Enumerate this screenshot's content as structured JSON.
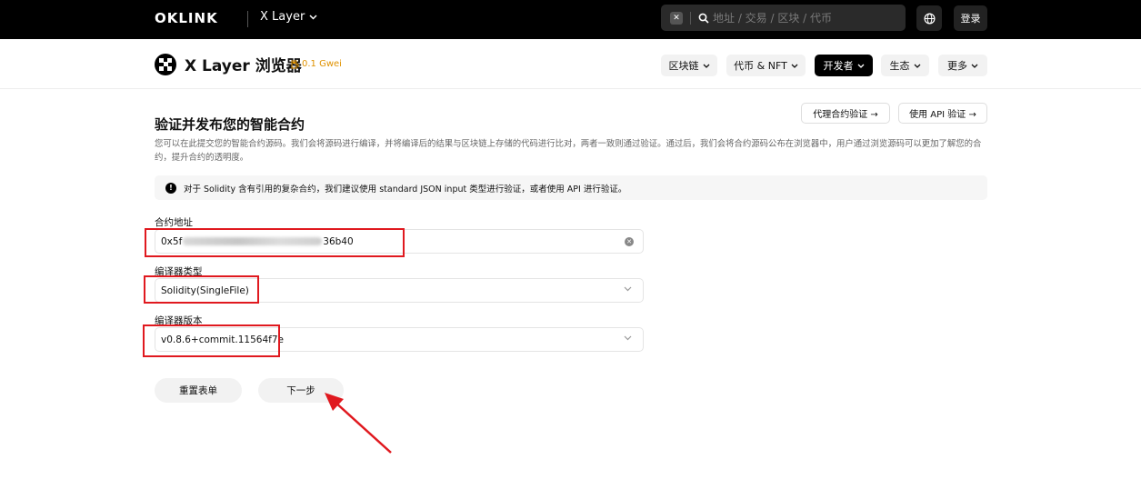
{
  "topbar": {
    "logo": "OKLINK",
    "chain": "X Layer",
    "search_placeholder": "地址 / 交易 / 区块 / 代币",
    "login": "登录"
  },
  "subheader": {
    "brand_title": "X Layer 浏览器",
    "gas": "0.1 Gwei",
    "nav": [
      "区块链",
      "代币 & NFT",
      "开发者",
      "生态",
      "更多"
    ],
    "active_nav": "开发者"
  },
  "page": {
    "proxy_verify": "代理合约验证 →",
    "api_verify": "使用 API 验证 →",
    "title": "验证并发布您的智能合约",
    "description": "您可以在此提交您的智能合约源码。我们会将源码进行编译，并将编译后的结果与区块链上存储的代码进行比对，两者一致则通过验证。通过后，我们会将合约源码公布在浏览器中，用户通过浏览源码可以更加了解您的合约，提升合约的透明度。",
    "notice": "对于 Solidity 含有引用的复杂合约，我们建议使用 standard JSON input 类型进行验证，或者使用 API 进行验证。"
  },
  "form": {
    "address_label": "合约地址",
    "address_prefix": "0x5f",
    "address_suffix": "36b40",
    "compiler_type_label": "编译器类型",
    "compiler_type_value": "Solidity(SingleFile)",
    "compiler_version_label": "编译器版本",
    "compiler_version_value": "v0.8.6+commit.11564f7e"
  },
  "buttons": {
    "reset": "重置表单",
    "next": "下一步"
  },
  "colors": {
    "highlight": "#e0191f",
    "gas": "#e09200",
    "topbar": "#000000"
  }
}
